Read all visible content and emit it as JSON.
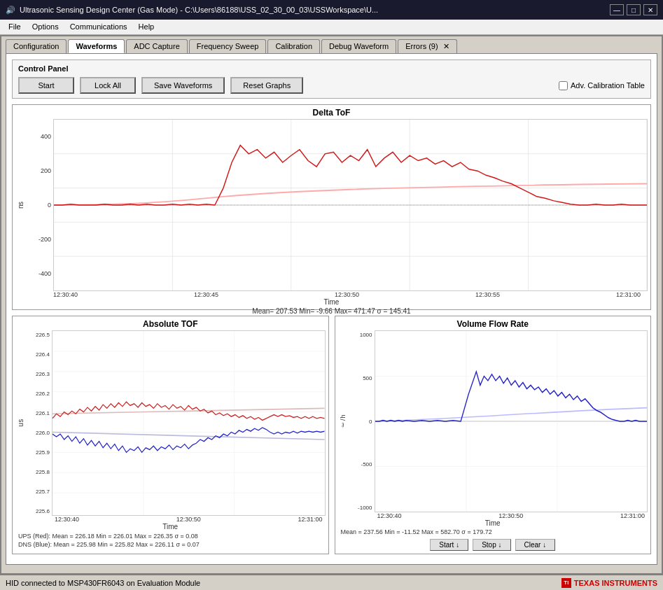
{
  "titleBar": {
    "icon": "🔊",
    "text": "Ultrasonic Sensing Design Center (Gas Mode) - C:\\Users\\86188\\USS_02_30_00_03\\USSWorkspace\\U...",
    "minimize": "—",
    "maximize": "□",
    "close": "✕"
  },
  "menuBar": {
    "items": [
      "File",
      "Options",
      "Communications",
      "Help"
    ]
  },
  "tabs": [
    {
      "label": "Configuration",
      "active": false
    },
    {
      "label": "Waveforms",
      "active": true
    },
    {
      "label": "ADC Capture",
      "active": false
    },
    {
      "label": "Frequency Sweep",
      "active": false
    },
    {
      "label": "Calibration",
      "active": false
    },
    {
      "label": "Debug Waveform",
      "active": false
    },
    {
      "label": "Errors (9)",
      "active": false,
      "closeable": true
    }
  ],
  "controlPanel": {
    "title": "Control Panel",
    "buttons": {
      "start": "Start",
      "lockAll": "Lock All",
      "saveWaveforms": "Save Waveforms",
      "resetGraphs": "Reset Graphs",
      "advCalibration": "Adv. Calibration Table"
    }
  },
  "deltaToF": {
    "title": "Delta ToF",
    "yLabel": "n\ns",
    "xLabel": "Time",
    "xTicks": [
      "12:30:40",
      "12:30:45",
      "12:30:50",
      "12:30:55",
      "12:31:00"
    ],
    "yTicks": [
      "-400",
      "-200",
      "0",
      "200",
      "400"
    ],
    "stats": "Mean= 207.53  Min= -9.66  Max= 471.47  σ = 145.41"
  },
  "absoluteTOF": {
    "title": "Absolute TOF",
    "yLabel": "u\ns",
    "xLabel": "Time",
    "xTicks": [
      "12:30:40",
      "12:30:50",
      "12:31:00"
    ],
    "yTicks": [
      "225.6",
      "225.7",
      "225.8",
      "225.9",
      "226.0",
      "226.1",
      "226.2",
      "226.3",
      "226.4",
      "226.5"
    ],
    "statsUPS": "UPS (Red): Mean = 226.18 Min = 226.01 Max = 226.35  σ = 0.08",
    "statsDNS": "DNS (Blue): Mean = 225.98 Min = 225.82 Max = 226.11  σ = 0.07"
  },
  "volumeFlowRate": {
    "title": "Volume Flow Rate",
    "yLabel": "ℓ\n/\nh",
    "xLabel": "Time",
    "xTicks": [
      "12:30:40",
      "12:30:50",
      "12:31:00"
    ],
    "yTicks": [
      "-1000",
      "-500",
      "0",
      "500",
      "1000"
    ],
    "stats": "Mean = 237.56  Min = -11.52  Max = 582.70  σ = 179.72",
    "buttons": {
      "start": "Start ↓",
      "stop": "Stop ↓",
      "clear": "Clear ↓"
    }
  },
  "statusBar": {
    "left": "HID connected to MSP430FR6043 on Evaluation Module",
    "logo": "TEXAS INSTRUMENTS"
  }
}
